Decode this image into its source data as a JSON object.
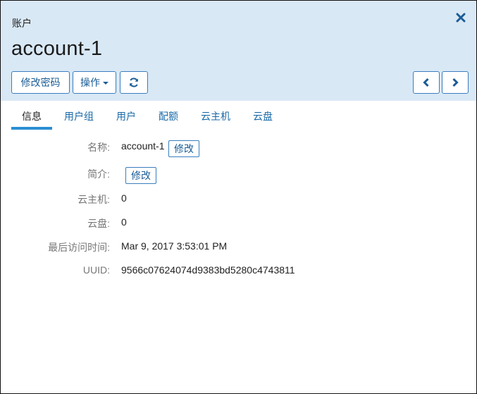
{
  "header": {
    "section_label": "账户",
    "title": "account-1",
    "toolbar": {
      "change_password_label": "修改密码",
      "operations_label": "操作"
    }
  },
  "icons": {
    "close": "close-icon",
    "refresh": "refresh-icon",
    "prev": "chevron-left-icon",
    "next": "chevron-right-icon",
    "dropdown": "caret-down-icon"
  },
  "tabs": [
    {
      "label": "信息",
      "active": true
    },
    {
      "label": "用户组",
      "active": false
    },
    {
      "label": "用户",
      "active": false
    },
    {
      "label": "配额",
      "active": false
    },
    {
      "label": "云主机",
      "active": false
    },
    {
      "label": "云盘",
      "active": false
    }
  ],
  "info": {
    "name": {
      "label": "名称:",
      "value": "account-1",
      "edit_label": "修改"
    },
    "description": {
      "label": "简介:",
      "value": "",
      "edit_label": "修改"
    },
    "vm_count": {
      "label": "云主机:",
      "value": "0"
    },
    "volume_count": {
      "label": "云盘:",
      "value": "0"
    },
    "last_access": {
      "label": "最后访问时间:",
      "value": "Mar 9, 2017 3:53:01 PM"
    },
    "uuid": {
      "label": "UUID:",
      "value": "9566c07624074d9383bd5280c4743811"
    }
  },
  "colors": {
    "header_bg": "#d9e8f5",
    "accent": "#1a5c96",
    "tab_link": "#1a6aa8",
    "tab_indicator": "#2a8ed3"
  }
}
